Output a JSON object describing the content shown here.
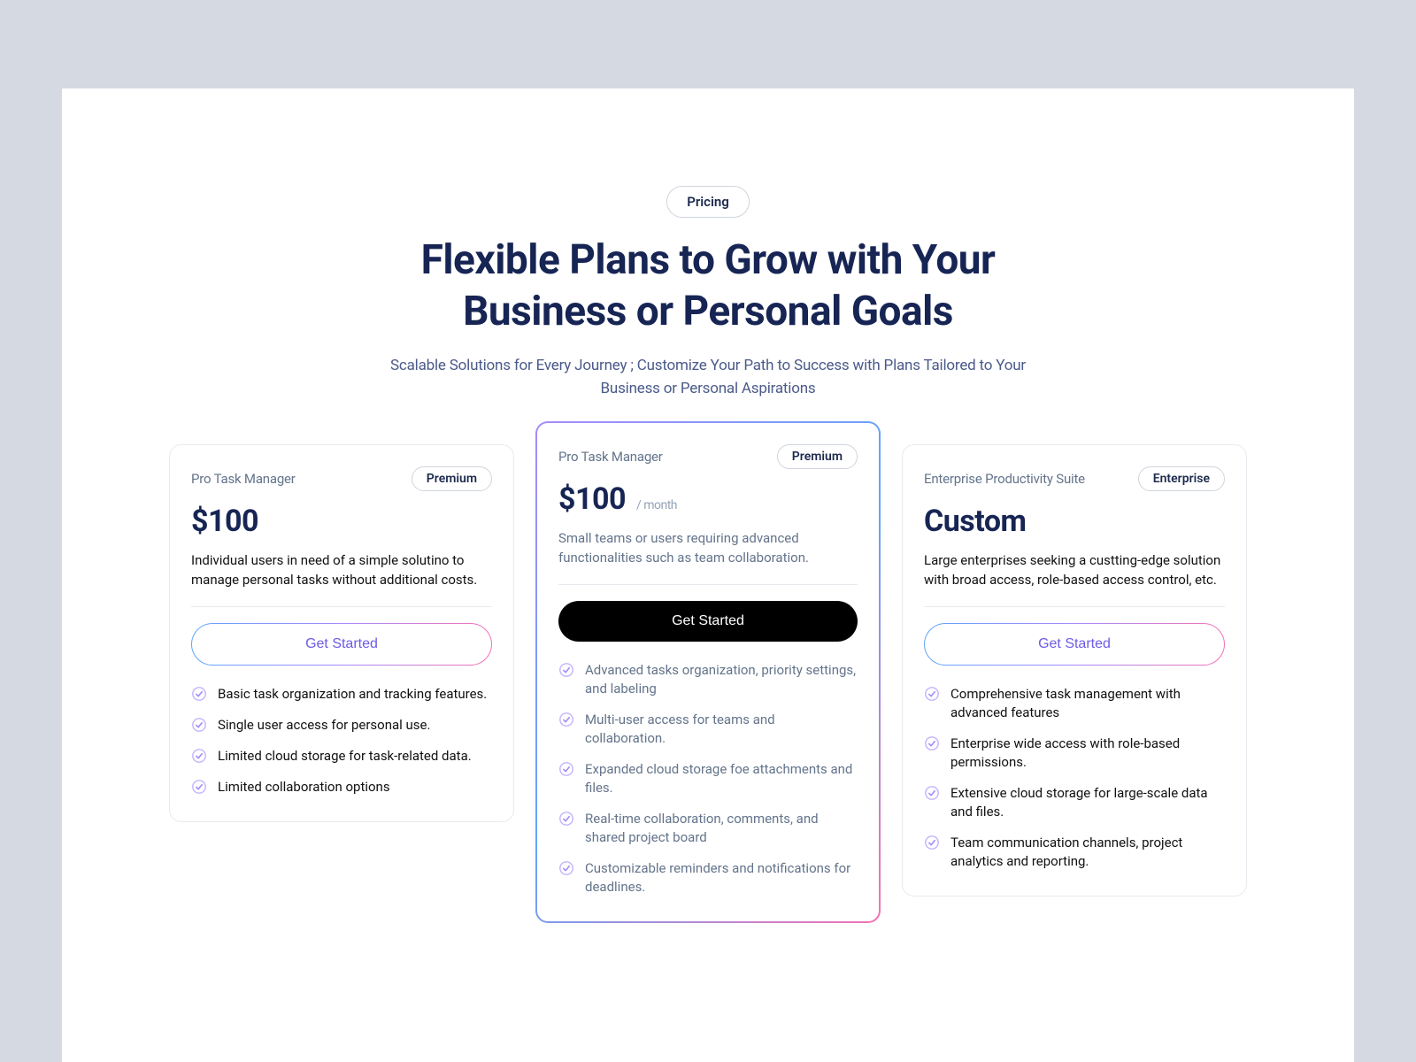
{
  "header": {
    "pill": "Pricing",
    "title": "Flexible Plans to Grow with Your Business or Personal Goals",
    "subtitle": "Scalable Solutions for Every Journey ; Customize Your Path to Success with Plans Tailored to Your Business or Personal Aspirations"
  },
  "plans": [
    {
      "name": "Pro Task Manager",
      "badge": "Premium",
      "price": "$100",
      "period": "",
      "desc": "Individual users in need of a simple solutino to manage personal tasks without additional costs.",
      "cta": "Get Started",
      "features": [
        "Basic task organization and tracking features.",
        "Single user access for personal use.",
        "Limited cloud storage for task-related data.",
        "Limited collaboration options"
      ]
    },
    {
      "name": "Pro Task Manager",
      "badge": "Premium",
      "price": "$100",
      "period": "/ month",
      "desc": "Small teams or users requiring advanced functionalities such as team collaboration.",
      "cta": "Get Started",
      "features": [
        "Advanced tasks organization, priority settings, and labeling",
        "Multi-user access for teams and collaboration.",
        "Expanded cloud storage foe attachments and files.",
        "Real-time collaboration, comments, and shared project board",
        "Customizable reminders and notifications for deadlines."
      ]
    },
    {
      "name": "Enterprise Productivity Suite",
      "badge": "Enterprise",
      "price": "Custom",
      "period": "",
      "desc": "Large enterprises seeking a custting-edge solution with broad access, role-based access control, etc.",
      "cta": "Get Started",
      "features": [
        "Comprehensive task management with advanced features",
        "Enterprise wide access with role-based permissions.",
        "Extensive cloud storage for large-scale data and files.",
        "Team communication channels, project analytics and reporting."
      ]
    }
  ]
}
